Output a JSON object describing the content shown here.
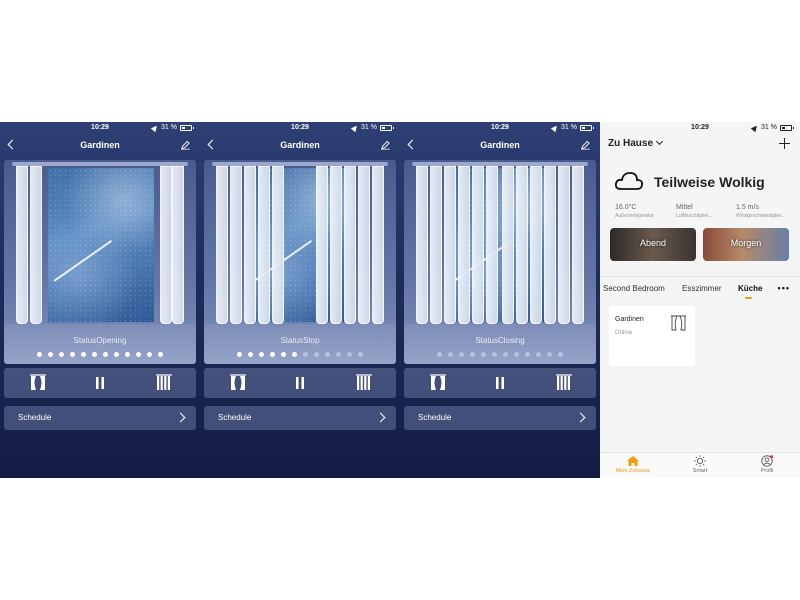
{
  "status_bar": {
    "time": "10:29",
    "battery": "31 %"
  },
  "curtain_screens": [
    {
      "title": "Gardinen",
      "status": "StatusOpening",
      "state": "open",
      "active_dots": 12,
      "total_dots": 12,
      "schedule_label": "Schedule"
    },
    {
      "title": "Gardinen",
      "status": "StatusStop",
      "state": "stop",
      "active_dots": 6,
      "total_dots": 12,
      "schedule_label": "Schedule"
    },
    {
      "title": "Gardinen",
      "status": "StatusClosing",
      "state": "closed",
      "active_dots": 0,
      "total_dots": 12,
      "schedule_label": "Schedule"
    }
  ],
  "home": {
    "title": "Zu Hause",
    "weather": {
      "condition": "Teilweise Wolkig",
      "temp": "16.0°C",
      "temp_label": "Außentemperatur",
      "humidity": "Mittel",
      "humidity_label": "Luftfeuchtigkei...",
      "wind": "1.5 m/s",
      "wind_label": "Windgeschwindigkei..."
    },
    "scenes": [
      "Abend",
      "Morgen"
    ],
    "rooms": [
      "Second Bedroom",
      "Esszimmer",
      "Küche"
    ],
    "active_room": "Küche",
    "device": {
      "name": "Gardinen",
      "status": "Online"
    },
    "tabbar": {
      "home": "Mein Zuhause",
      "smart": "Smart",
      "profile": "Profil"
    },
    "colors": {
      "accent": "#f39c12"
    }
  }
}
